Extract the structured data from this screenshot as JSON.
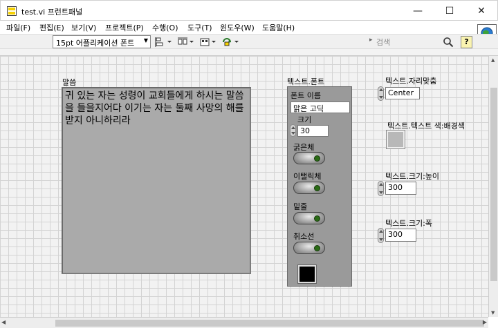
{
  "window": {
    "title": "test.vi 프런트패널",
    "minimize": "—",
    "maximize": "☐",
    "close": "✕"
  },
  "menu": [
    "파일(F)",
    "편집(E)",
    "보기(V)",
    "프로젝트(P)",
    "수행(O)",
    "도구(T)",
    "윈도우(W)",
    "도움말(H)"
  ],
  "toolbar": {
    "font_select": "15pt 어플리케이션 폰트",
    "search_placeholder": "검색",
    "help_label": "?",
    "icons": [
      "align-objects-icon",
      "distribute-objects-icon",
      "resize-objects-icon",
      "reorder-icon"
    ]
  },
  "front_panel": {
    "speech": {
      "label": "말씀",
      "text": "귀 있는 자는 성령이 교회들에게 하시는 말씀을 들을지어다 이기는 자는 둘째 사망의 해를 받지 아니하리라"
    },
    "text_font_cluster": {
      "label": "텍스트.폰트",
      "font_name_label": "폰트 이름",
      "font_name_value": "맑은 고딕",
      "size_label": "크기",
      "size_value": "30",
      "bold_label": "굵은체",
      "italic_label": "이탤릭체",
      "underline_label": "밑줄",
      "strikeout_label": "취소선",
      "bold_on": false,
      "italic_on": false,
      "underline_on": false,
      "strikeout_on": false,
      "color": "#000000"
    },
    "justify": {
      "label": "텍스트.자리맞춤",
      "value": "Center"
    },
    "text_colors": {
      "label": "텍스트.텍스트 색:배경색",
      "bg_color": "#b8b8b8"
    },
    "height": {
      "label": "텍스트.크기:높이",
      "value": "300"
    },
    "width": {
      "label": "텍스트.크기:폭",
      "value": "300"
    }
  }
}
